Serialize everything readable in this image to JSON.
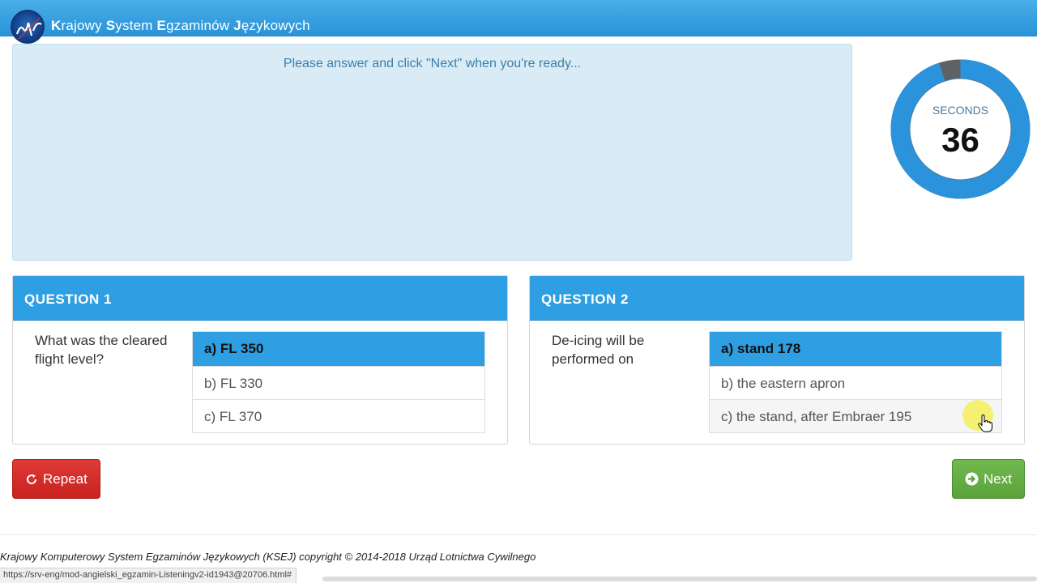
{
  "header": {
    "brand_parts": [
      {
        "initial": "K",
        "rest": "rajowy "
      },
      {
        "initial": "S",
        "rest": "ystem "
      },
      {
        "initial": "E",
        "rest": "gzaminów "
      },
      {
        "initial": "J",
        "rest": "ęzykowych"
      }
    ],
    "logo_icon": "ulc-logo-icon",
    "bar_color": "#2f9fe3"
  },
  "instruction": {
    "text": "Please answer and click \"Next\" when you're ready..."
  },
  "timer": {
    "label": "SECONDS",
    "value": "36",
    "remaining_fraction": 0.95,
    "ring_color": "#2b93dc",
    "elapsed_color": "#5e6266"
  },
  "questions": [
    {
      "title": "QUESTION 1",
      "text": "What was the cleared flight level?",
      "options": [
        {
          "label": "a) FL 350",
          "selected": true
        },
        {
          "label": "b) FL 330",
          "selected": false
        },
        {
          "label": "c) FL 370",
          "selected": false
        }
      ]
    },
    {
      "title": "QUESTION 2",
      "text": "De-icing will be performed on",
      "options": [
        {
          "label": "a) stand 178",
          "selected": true
        },
        {
          "label": "b) the eastern apron",
          "selected": false
        },
        {
          "label": "c) the stand, after Embraer 195",
          "selected": false
        }
      ]
    }
  ],
  "buttons": {
    "repeat_label": "Repeat",
    "repeat_icon": "refresh-icon",
    "next_label": "Next",
    "next_icon": "arrow-circle-right-icon"
  },
  "footer": {
    "copyright": "Krajowy Komputerowy System Egzaminów Językowych (KSEJ) copyright © 2014-2018 Urząd Lotnictwa Cywilnego"
  },
  "status_bar": {
    "url": "https://srv-eng/mod-angielski_egzamin-Listeningv2-id1943@20706.html#"
  }
}
